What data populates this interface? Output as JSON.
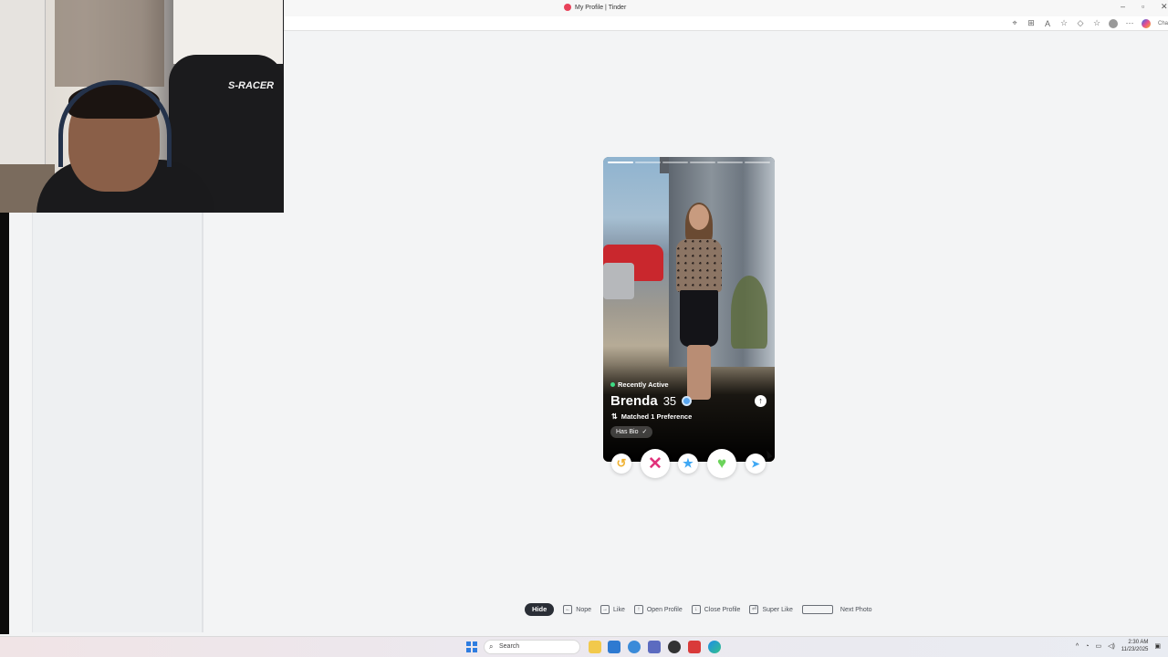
{
  "browser": {
    "tab_title": "My Profile | Tinder",
    "win_controls": [
      "–",
      "▫",
      "✕"
    ],
    "addr_icons": [
      "⌖",
      "⊞",
      "A",
      "☆",
      "◇",
      "☆"
    ],
    "copilot_label": "Cha"
  },
  "webcam": {
    "chair_brand": "S-RACER"
  },
  "card": {
    "status": "Recently Active",
    "name": "Brenda",
    "age": "35",
    "info_icon": "↑",
    "preference": "Matched 1 Preference",
    "preference_icon": "⇅",
    "bio_badge": "Has Bio",
    "bio_check": "✓",
    "photo_count": 6,
    "active_photo": 0
  },
  "actions": {
    "rewind": "↺",
    "nope": "✕",
    "super_like": "★",
    "like": "♥",
    "boost": "➤"
  },
  "shortcuts": {
    "hide_label": "Hide",
    "items": [
      {
        "key": "←",
        "label": "Nope"
      },
      {
        "key": "→",
        "label": "Like"
      },
      {
        "key": "↑",
        "label": "Open Profile"
      },
      {
        "key": "↓",
        "label": "Close Profile"
      },
      {
        "key": "⏎",
        "label": "Super Like"
      },
      {
        "key": "",
        "label": "Next Photo"
      }
    ]
  },
  "taskbar": {
    "search_placeholder": "Search",
    "search_icon": "⌕",
    "tray_chevron": "^",
    "time": "2:30 AM",
    "date": "11/23/2025"
  },
  "colors": {
    "tinder_red": "#e8425a",
    "nope_pink": "#e0327b",
    "super_blue": "#3fa8f4",
    "like_green": "#6bd35a",
    "rewind_gold": "#f0b232"
  }
}
